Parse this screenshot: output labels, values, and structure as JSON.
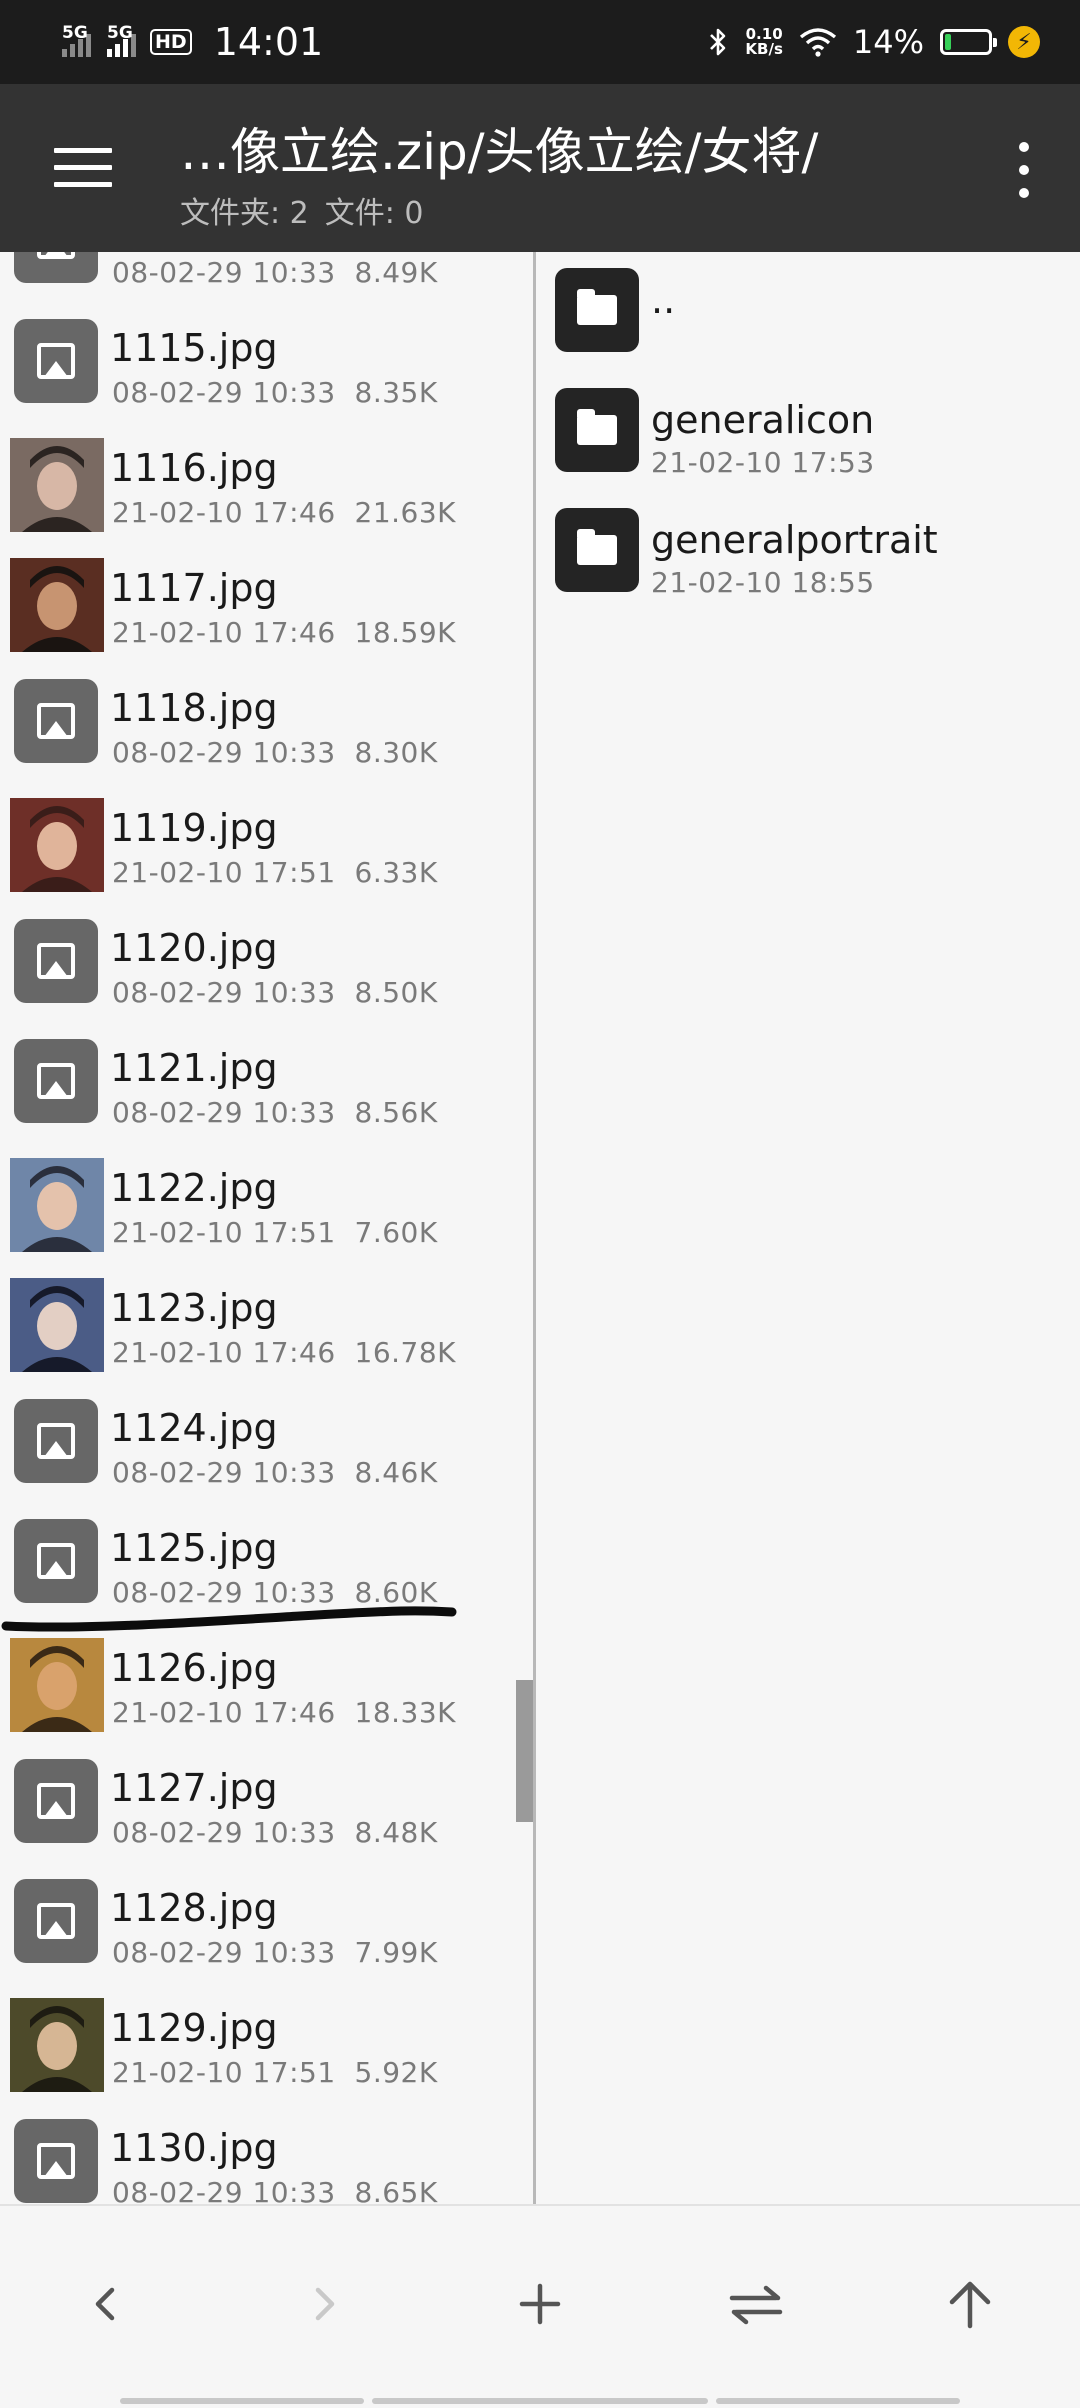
{
  "status_bar": {
    "signal1": "5G",
    "signal2": "5G",
    "hd": "HD",
    "time": "14:01",
    "net_speed_value": "0.10",
    "net_speed_unit": "KB/s",
    "battery_percent": "14%",
    "battery_level": 0.14,
    "battery_color": "#37d159"
  },
  "app_bar": {
    "path": "…像立绘.zip/头像立绘/女将/",
    "folder_count_label": "文件夹: 2",
    "file_count_label": "文件: 0",
    "menu_icon": "hamburger-menu-icon",
    "overflow_icon": "more-vert-icon"
  },
  "left_pane": {
    "items": [
      {
        "name": "",
        "date": "08-02-29 10:33",
        "size": "8.49K",
        "thumb": "generic"
      },
      {
        "name": "1115.jpg",
        "date": "08-02-29 10:33",
        "size": "8.35K",
        "thumb": "generic"
      },
      {
        "name": "1116.jpg",
        "date": "21-02-10 17:46",
        "size": "21.63K",
        "thumb": "portrait",
        "palette": [
          "#7a6a62",
          "#d7b7a6",
          "#2b2421"
        ]
      },
      {
        "name": "1117.jpg",
        "date": "21-02-10 17:46",
        "size": "18.59K",
        "thumb": "portrait",
        "palette": [
          "#5a2e22",
          "#c79471",
          "#1a1411"
        ]
      },
      {
        "name": "1118.jpg",
        "date": "08-02-29 10:33",
        "size": "8.30K",
        "thumb": "generic"
      },
      {
        "name": "1119.jpg",
        "date": "21-02-10 17:51",
        "size": "6.33K",
        "thumb": "portrait",
        "palette": [
          "#6e2f28",
          "#e0b49a",
          "#3a1d19"
        ]
      },
      {
        "name": "1120.jpg",
        "date": "08-02-29 10:33",
        "size": "8.50K",
        "thumb": "generic"
      },
      {
        "name": "1121.jpg",
        "date": "08-02-29 10:33",
        "size": "8.56K",
        "thumb": "generic"
      },
      {
        "name": "1122.jpg",
        "date": "21-02-10 17:51",
        "size": "7.60K",
        "thumb": "portrait",
        "palette": [
          "#6f86a8",
          "#e4c2ac",
          "#2a2f3d"
        ]
      },
      {
        "name": "1123.jpg",
        "date": "21-02-10 17:46",
        "size": "16.78K",
        "thumb": "portrait",
        "palette": [
          "#4b5c86",
          "#e3cfc4",
          "#161a2a"
        ]
      },
      {
        "name": "1124.jpg",
        "date": "08-02-29 10:33",
        "size": "8.46K",
        "thumb": "generic"
      },
      {
        "name": "1125.jpg",
        "date": "08-02-29 10:33",
        "size": "8.60K",
        "thumb": "generic"
      },
      {
        "name": "1126.jpg",
        "date": "21-02-10 17:46",
        "size": "18.33K",
        "thumb": "portrait",
        "palette": [
          "#b8883e",
          "#d9a26c",
          "#3b2a16"
        ]
      },
      {
        "name": "1127.jpg",
        "date": "08-02-29 10:33",
        "size": "8.48K",
        "thumb": "generic"
      },
      {
        "name": "1128.jpg",
        "date": "08-02-29 10:33",
        "size": "7.99K",
        "thumb": "generic"
      },
      {
        "name": "1129.jpg",
        "date": "21-02-10 17:51",
        "size": "5.92K",
        "thumb": "portrait",
        "palette": [
          "#4d4a2a",
          "#d6b694",
          "#1e1c12"
        ]
      },
      {
        "name": "1130.jpg",
        "date": "08-02-29 10:33",
        "size": "8.65K",
        "thumb": "generic"
      }
    ]
  },
  "right_pane": {
    "items": [
      {
        "name": "..",
        "date": ""
      },
      {
        "name": "generalicon",
        "date": "21-02-10 17:53"
      },
      {
        "name": "generalportrait",
        "date": "21-02-10 18:55"
      }
    ]
  },
  "toolbar": {
    "back_icon": "chevron-left-icon",
    "forward_icon": "chevron-right-icon",
    "add_icon": "plus-icon",
    "swap_icon": "swap-horizontal-icon",
    "up_icon": "arrow-up-icon"
  }
}
